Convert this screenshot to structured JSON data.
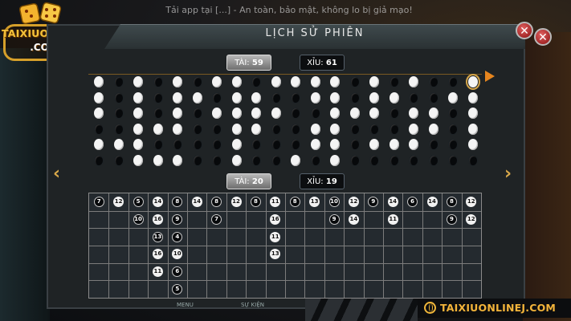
{
  "banner": "Tải app tại [...] - An toàn, bảo mật, không lo bị giả mạo!",
  "logo": {
    "name": "TAIXIUONLINEJ",
    "domain": ".COM"
  },
  "dialog": {
    "title": "LỊCH SỬ PHIÊN",
    "close_symbol": "✕"
  },
  "summary_top": {
    "tai_label": "TÀI:",
    "tai_value": "59",
    "xiu_label": "XỈU:",
    "xiu_value": "61"
  },
  "summary_bottom": {
    "tai_label": "TÀI:",
    "tai_value": "20",
    "xiu_label": "XỈU:",
    "xiu_value": "19"
  },
  "nav": {
    "prev_symbol": "‹",
    "next_symbol": "›"
  },
  "bead_road": {
    "columns": [
      [
        "w",
        "w",
        "w",
        "b",
        "w",
        "b"
      ],
      [
        "b",
        "b",
        "b",
        "b",
        "w",
        "b"
      ],
      [
        "w",
        "w",
        "w",
        "w",
        "w",
        "w"
      ],
      [
        "b",
        "b",
        "b",
        "w",
        "b",
        "w"
      ],
      [
        "w",
        "w",
        "w",
        "w",
        "b",
        "w"
      ],
      [
        "b",
        "w",
        "b",
        "b",
        "b",
        "b"
      ],
      [
        "w",
        "b",
        "w",
        "b",
        "b",
        "b"
      ],
      [
        "w",
        "w",
        "w",
        "w",
        "w",
        "w"
      ],
      [
        "b",
        "w",
        "w",
        "w",
        "b",
        "b"
      ],
      [
        "w",
        "b",
        "w",
        "b",
        "b",
        "b"
      ],
      [
        "w",
        "b",
        "b",
        "b",
        "b",
        "w"
      ],
      [
        "w",
        "w",
        "b",
        "w",
        "w",
        "b"
      ],
      [
        "w",
        "w",
        "w",
        "w",
        "w",
        "w"
      ],
      [
        "b",
        "b",
        "w",
        "b",
        "b",
        "b"
      ],
      [
        "w",
        "w",
        "w",
        "b",
        "w",
        "b"
      ],
      [
        "b",
        "w",
        "b",
        "b",
        "w",
        "b"
      ],
      [
        "w",
        "b",
        "w",
        "w",
        "w",
        "b"
      ],
      [
        "b",
        "b",
        "w",
        "w",
        "b",
        "b"
      ],
      [
        "b",
        "w",
        "b",
        "b",
        "b",
        "b"
      ],
      [
        "ring",
        "w",
        "w",
        "w",
        "w",
        "b"
      ]
    ]
  },
  "sum_road": {
    "columns": [
      [
        [
          "b",
          "7"
        ]
      ],
      [
        [
          "w",
          "12"
        ]
      ],
      [
        [
          "b",
          "5"
        ],
        [
          "b",
          "10"
        ]
      ],
      [
        [
          "w",
          "14"
        ],
        [
          "w",
          "16"
        ],
        [
          "b",
          "13"
        ],
        [
          "w",
          "16"
        ],
        [
          "w",
          "11"
        ]
      ],
      [
        [
          "b",
          "8"
        ],
        [
          "b",
          "9"
        ],
        [
          "b",
          "4"
        ],
        [
          "w",
          "10"
        ],
        [
          "b",
          "6"
        ],
        [
          "b",
          "5"
        ]
      ],
      [
        [
          "w",
          "14"
        ]
      ],
      [
        [
          "b",
          "8"
        ],
        [
          "b",
          "7"
        ]
      ],
      [
        [
          "w",
          "12"
        ]
      ],
      [
        [
          "b",
          "8"
        ]
      ],
      [
        [
          "w",
          "11"
        ],
        [
          "w",
          "16"
        ],
        [
          "w",
          "11"
        ],
        [
          "w",
          "13"
        ]
      ],
      [
        [
          "b",
          "8"
        ]
      ],
      [
        [
          "w",
          "13"
        ]
      ],
      [
        [
          "b",
          "10"
        ],
        [
          "b",
          "9"
        ]
      ],
      [
        [
          "w",
          "12"
        ],
        [
          "w",
          "14"
        ]
      ],
      [
        [
          "b",
          "9"
        ]
      ],
      [
        [
          "w",
          "14"
        ],
        [
          "w",
          "11"
        ]
      ],
      [
        [
          "b",
          "6"
        ]
      ],
      [
        [
          "w",
          "14"
        ]
      ],
      [
        [
          "b",
          "8"
        ],
        [
          "b",
          "9"
        ]
      ],
      [
        [
          "w",
          "12"
        ],
        [
          "w",
          "12"
        ]
      ]
    ]
  },
  "site_badge": "TAIXIUONLINEJ.COM",
  "footer": {
    "menu": "MENU",
    "event": "SỰ KIỆN"
  }
}
